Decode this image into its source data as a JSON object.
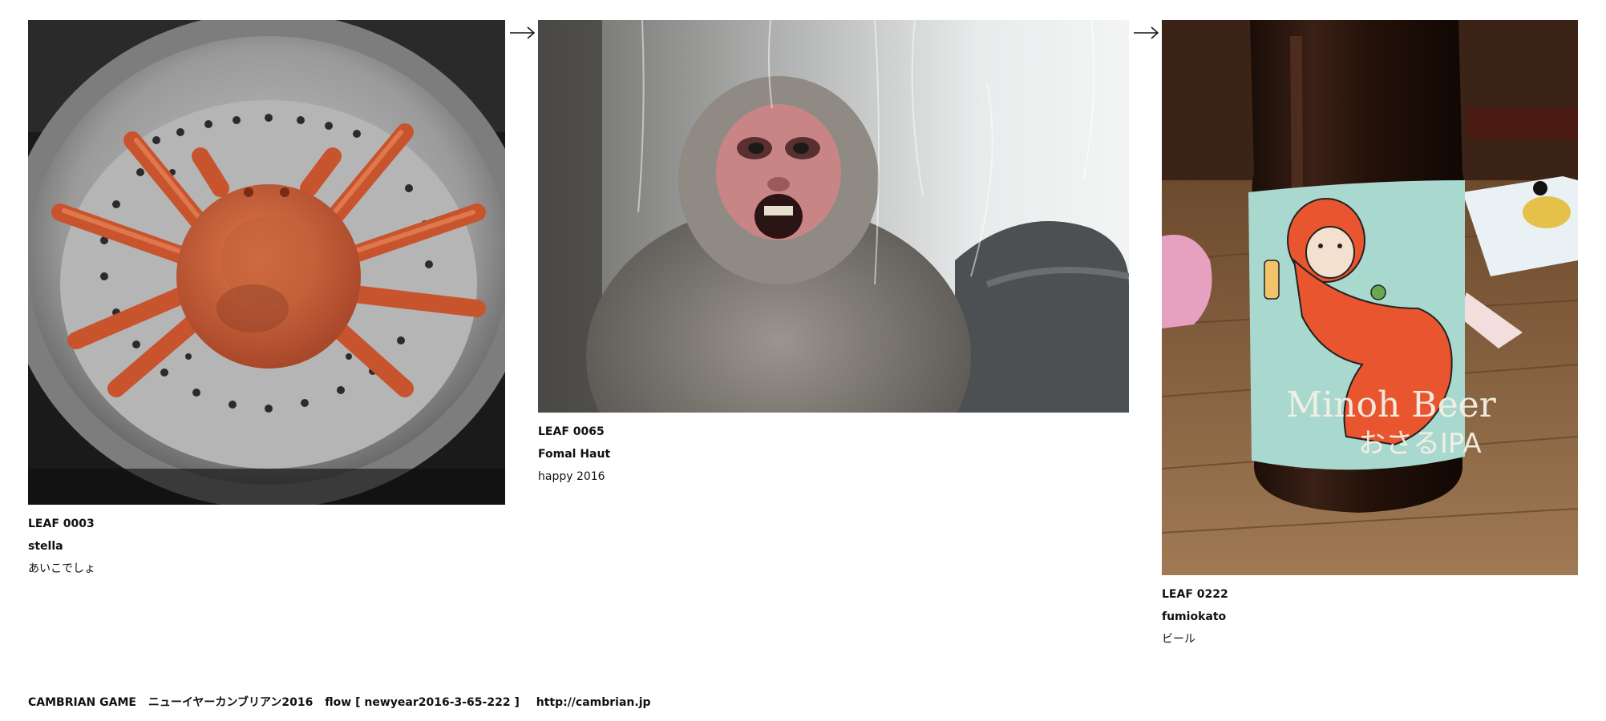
{
  "leaves": [
    {
      "id": "LEAF 0003",
      "author": "stella",
      "comment": "あいこでしょ",
      "photo": "steamed-crab-in-steamer"
    },
    {
      "id": "LEAF 0065",
      "author": "Fomal Haut",
      "comment": "happy 2016",
      "photo": "snow-monkey-behind-glass"
    },
    {
      "id": "LEAF 0222",
      "author": "fumiokato",
      "comment": "ビール",
      "photo": "minoh-beer-bottle",
      "label_text_line1": "Minoh Beer",
      "label_text_line2": "おさるIPA"
    }
  ],
  "arrows": [
    "arrow-right-icon",
    "arrow-right-icon"
  ],
  "footer": {
    "game": "CAMBRIAN GAME",
    "title": "ニューイヤーカンブリアン2016",
    "flow": "flow [ newyear2016-3-65-222 ]",
    "url": "http://cambrian.jp"
  },
  "colors": {
    "text": "#111111",
    "background": "#ffffff",
    "crab": "#d2613a",
    "beer_label": "#a9d8cf",
    "monkey_face": "#c98585"
  }
}
